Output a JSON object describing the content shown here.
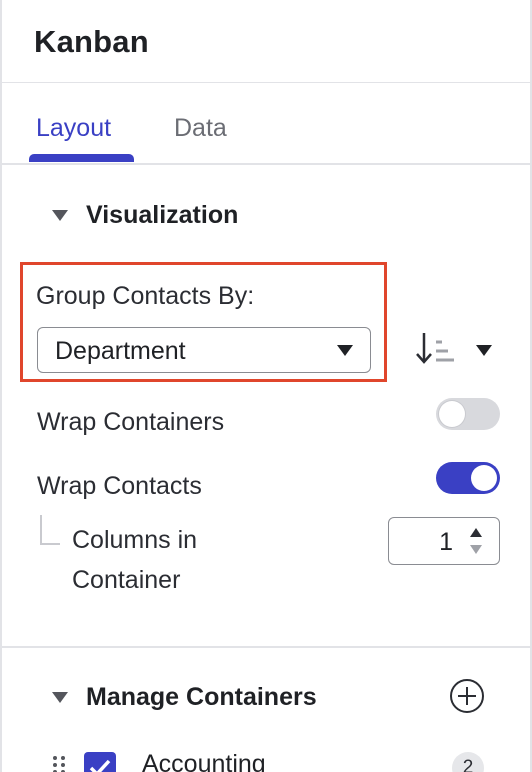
{
  "panel": {
    "title": "Kanban"
  },
  "tabs": [
    {
      "label": "Layout",
      "active": true
    },
    {
      "label": "Data",
      "active": false
    }
  ],
  "visualization": {
    "section_label": "Visualization",
    "group_by": {
      "label": "Group Contacts By:",
      "value": "Department"
    },
    "sort_icon": "sort-descending-icon",
    "wrap_containers": {
      "label": "Wrap Containers",
      "on": false
    },
    "wrap_contacts": {
      "label": "Wrap Contacts",
      "on": true
    },
    "columns_in_container": {
      "label": "Columns in Container",
      "value": "1"
    }
  },
  "manage_containers": {
    "section_label": "Manage Containers",
    "add_icon": "plus-circle-icon",
    "items": [
      {
        "label": "Accounting",
        "checked": true,
        "count": "2"
      }
    ]
  },
  "colors": {
    "accent": "#3a40c4",
    "highlight": "#e0462c",
    "toggle_off": "#d8d9dd"
  }
}
